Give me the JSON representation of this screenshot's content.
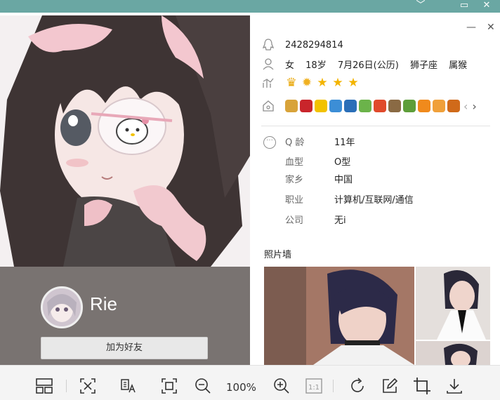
{
  "viewer": {
    "controls": {
      "minimize": "﹀",
      "restore": "▭",
      "close": "✕"
    },
    "toolbar": {
      "zoom": "100%",
      "one_to_one": "1:1",
      "icons": [
        "gallery-icon",
        "fit-window-icon",
        "ocr-icon",
        "fullscreen-icon",
        "zoom-out-icon",
        "zoom-in-icon",
        "actual-size-icon",
        "rotate-icon",
        "edit-icon",
        "crop-icon",
        "download-icon"
      ]
    }
  },
  "card": {
    "controls": {
      "minimize": "—",
      "close": "✕"
    },
    "profile": {
      "nickname": "Rie",
      "add_friend": "加为好友"
    },
    "info": {
      "qq_number": "2428294814",
      "gender": "女",
      "age": "18岁",
      "birthday": "7月26日(公历)",
      "zodiac": "狮子座",
      "chinese_zodiac": "属猴",
      "level_badges": [
        "crown",
        "sun",
        "star",
        "star",
        "star"
      ],
      "service_badges": [
        "#d8a33a",
        "#c9252b",
        "#f2c200",
        "#3c8ed6",
        "#2a6fb8",
        "#6bb34a",
        "#e04a2b",
        "#8a6a44",
        "#5e9e3a",
        "#f08a1c",
        "#f0a03a",
        "#d06a1a"
      ],
      "nav_prev": "‹",
      "nav_next": "›"
    },
    "details": [
      {
        "label": "Q 龄",
        "value": "11年"
      },
      {
        "label": "血型",
        "value": "O型"
      },
      {
        "label": "家乡",
        "value": "中国"
      },
      {
        "label": "职业",
        "value": "计算机/互联网/通信"
      },
      {
        "label": "公司",
        "value": "无i"
      }
    ],
    "photo_wall": {
      "title": "照片墙"
    },
    "colors": {
      "accent": "#6aa7a3",
      "left_panel": "#797371",
      "star": "#f3b400"
    }
  }
}
